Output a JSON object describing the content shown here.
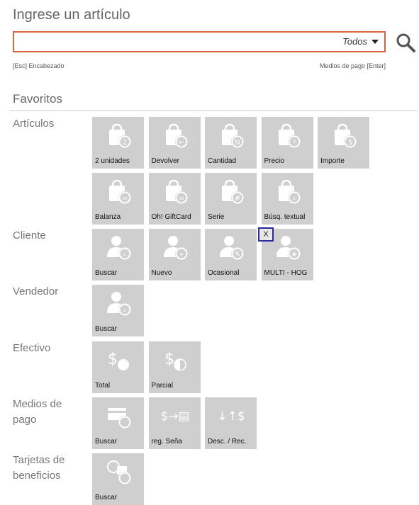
{
  "header": {
    "title": "Ingrese un artículo",
    "filter_label": "Todos",
    "hint_left": "[Esc] Encabezado",
    "hint_right": "Medios de pago [Enter]"
  },
  "favorites": {
    "title": "Favoritos",
    "categories": {
      "articulos": "Artículos",
      "cliente": "Cliente",
      "vendedor": "Vendedor",
      "efectivo": "Efectivo",
      "medios_pago": "Medios de pago",
      "tarjetas": "Tarjetas de beneficios"
    },
    "articulos": [
      "2 unidades",
      "Devolver",
      "Cantidad",
      "Precio",
      "Importe",
      "Balanza",
      "Oh! GiftCard",
      "Serie",
      "Búsq. textual"
    ],
    "cliente": [
      "Buscar",
      "Nuevo",
      "Ocasional",
      "MULTI - HOG"
    ],
    "vendedor": [
      "Buscar"
    ],
    "efectivo": [
      "Total",
      "Parcial"
    ],
    "medios_pago": [
      "Buscar",
      "reg. Seña",
      "Desc. / Rec."
    ],
    "tarjetas": [
      "Buscar"
    ],
    "close_badge": "X"
  },
  "icons": {
    "articulos": [
      "bag-2-icon",
      "bag-return-icon",
      "bag-count-icon",
      "bag-price-icon",
      "bag-amount-icon",
      "bag-scale-icon",
      "bag-giftcard-icon",
      "bag-serial-icon",
      "bag-search-icon"
    ],
    "cliente": [
      "user-search-icon",
      "user-add-icon",
      "user-edit-icon",
      "user-star-icon"
    ]
  },
  "colors": {
    "accent": "#d9643f",
    "tile": "#cfcfcf",
    "badge_border": "#2a2aa0"
  }
}
